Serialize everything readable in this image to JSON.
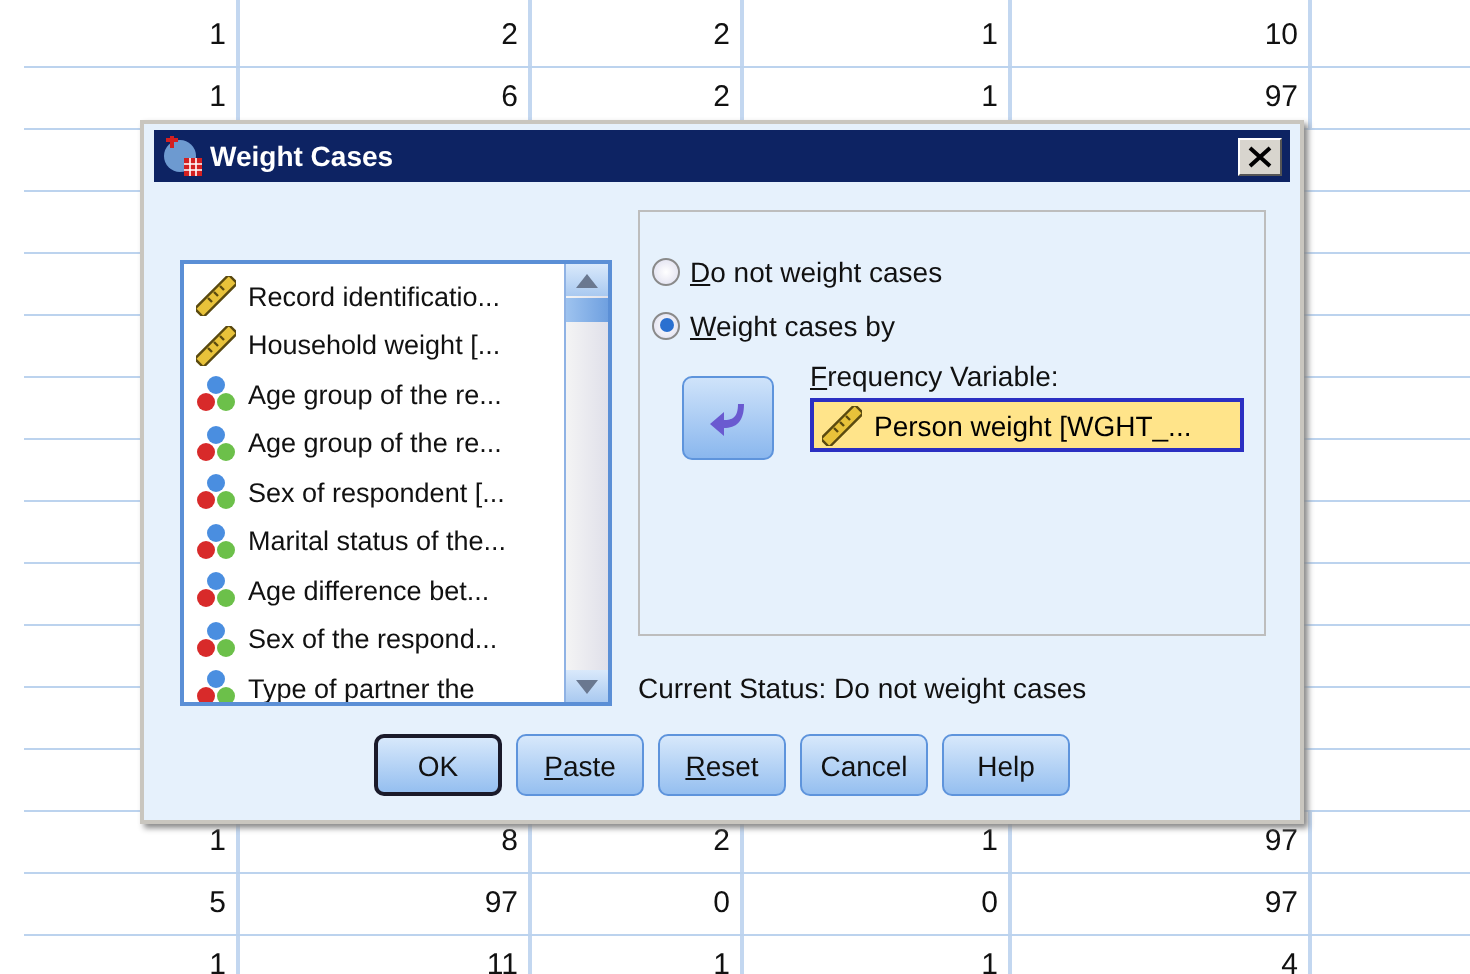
{
  "sheet": {
    "top_rows": [
      [
        "1",
        "2",
        "2",
        "1",
        "10"
      ],
      [
        "1",
        "6",
        "2",
        "1",
        "97"
      ]
    ],
    "bottom_rows": [
      [
        "1",
        "8",
        "2",
        "1",
        "97"
      ],
      [
        "5",
        "97",
        "0",
        "0",
        "97"
      ],
      [
        "1",
        "11",
        "1",
        "1",
        "4"
      ]
    ]
  },
  "dialog": {
    "title": "Weight Cases",
    "variables": [
      {
        "kind": "scale",
        "label": "Record identificatio..."
      },
      {
        "kind": "scale",
        "label": "Household weight [..."
      },
      {
        "kind": "nominal",
        "label": "Age group of the re..."
      },
      {
        "kind": "nominal",
        "label": "Age group of the re..."
      },
      {
        "kind": "nominal",
        "label": "Sex of respondent [..."
      },
      {
        "kind": "nominal",
        "label": "Marital status of the..."
      },
      {
        "kind": "nominal",
        "label": "Age difference bet..."
      },
      {
        "kind": "nominal",
        "label": "Sex of the respond..."
      },
      {
        "kind": "nominal",
        "label": "Type of partner the"
      }
    ],
    "options": [
      {
        "key": "D",
        "rest": "o not weight cases",
        "selected": false
      },
      {
        "key": "W",
        "rest": "eight cases by",
        "selected": true
      }
    ],
    "frequency_label": {
      "key": "F",
      "rest": "requency Variable:"
    },
    "frequency_value": {
      "kind": "scale",
      "label": "Person weight [WGHT_..."
    },
    "status": "Current Status: Do not weight cases",
    "buttons": [
      {
        "rest": "OK",
        "default": true
      },
      {
        "key": "P",
        "rest": "aste",
        "default": false
      },
      {
        "key": "R",
        "rest": "eset",
        "default": false
      },
      {
        "rest": "Cancel",
        "default": false
      },
      {
        "rest": "Help",
        "default": false
      }
    ]
  }
}
